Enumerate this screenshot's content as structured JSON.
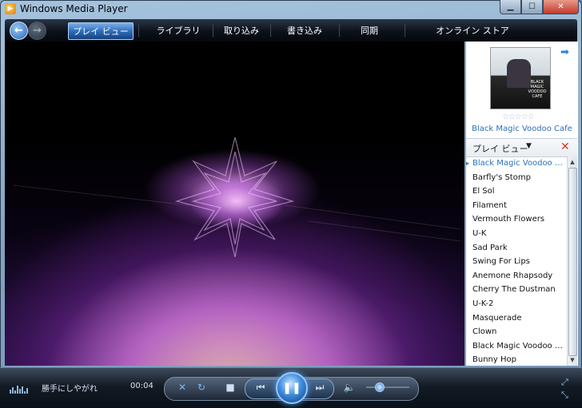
{
  "window": {
    "title": "Windows Media Player"
  },
  "nav": {
    "tabs": [
      {
        "label": "プレイ ビュー",
        "active": true
      },
      {
        "label": "ライブラリ"
      },
      {
        "label": "取り込み"
      },
      {
        "label": "書き込み"
      },
      {
        "label": "同期"
      },
      {
        "label": "オンライン ストア"
      }
    ]
  },
  "sidebar": {
    "album_art_text": "BLACK MAGIC VOODOO CAFE",
    "rating_stars": "☆☆☆☆☆",
    "album_title": "Black Magic Voodoo Cafe",
    "playlist_label": "プレイ ビュー",
    "playlist": [
      "Black Magic Voodoo Ca...",
      "Barfly's Stomp",
      "El Sol",
      "Filament",
      "Vermouth Flowers",
      "U-K",
      "Sad Park",
      "Swing For Lips",
      "Anemone Rhapsody",
      "Cherry The Dustman",
      "U-K-2",
      "Masquerade",
      "Clown",
      "Black Magic Voodoo Ca...",
      "Bunny Hop"
    ],
    "current_index": 0
  },
  "controls": {
    "status_text": "勝手にしやがれ",
    "time": "00:04",
    "volume_level": 0.3,
    "play_state": "playing"
  },
  "icons": {
    "accent": "#2a70b9",
    "remove": "#d13b2a"
  }
}
